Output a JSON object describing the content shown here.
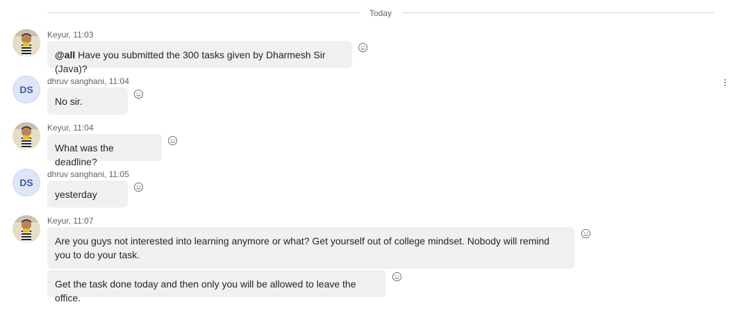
{
  "divider": {
    "label": "Today"
  },
  "messages": [
    {
      "author": "Keyur",
      "time": "11:03",
      "header": "Keyur, 11:03",
      "mention": "@all",
      "text": "Have you submitted the 300 tasks given by Dharmesh Sir (Java)?"
    },
    {
      "author": "dhruv sanghani",
      "time": "11:04",
      "header": "dhruv sanghani, 11:04",
      "initials": "DS",
      "text": "No sir."
    },
    {
      "author": "Keyur",
      "time": "11:04",
      "header": "Keyur, 11:04",
      "text": "What was the deadline?"
    },
    {
      "author": "dhruv sanghani",
      "time": "11:05",
      "header": "dhruv sanghani, 11:05",
      "initials": "DS",
      "text": "yesterday"
    },
    {
      "author": "Keyur",
      "time": "11:07",
      "header": "Keyur, 11:07",
      "text": "Are you guys not interested into learning anymore or what? Get yourself out of college mindset. Nobody will remind you to do your task.",
      "followup": "Get the task done today and then only you will be allowed to leave the office."
    }
  ],
  "icons": {
    "reaction": "smiley-reaction-icon",
    "more": "more-options-icon",
    "avatar_photo": "user-photo-avatar"
  },
  "colors": {
    "bubble": "#f0f0f0",
    "initials_bg": "#dfe6f7",
    "initials_text": "#3b5ba9"
  }
}
